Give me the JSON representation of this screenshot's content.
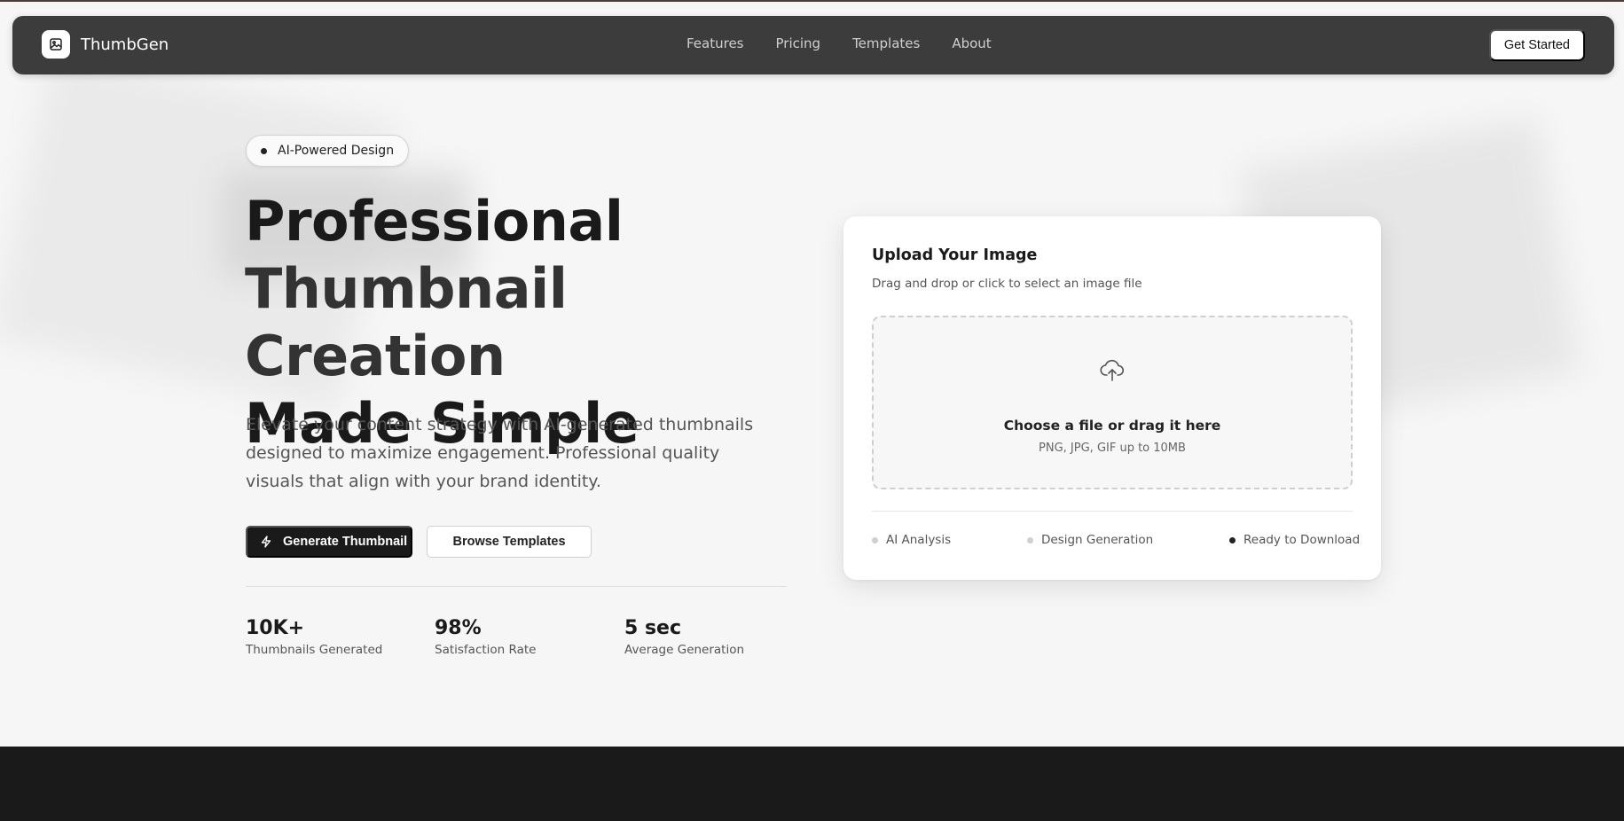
{
  "nav": {
    "logo_text": "ThumbGen",
    "links": [
      "Features",
      "Pricing",
      "Templates",
      "About"
    ],
    "cta_label": "Get Started"
  },
  "hero": {
    "badge": "AI-Powered Design",
    "title_lines": [
      "Professional",
      "Thumbnail Creation",
      "Made Simple"
    ],
    "description": "Elevate your content strategy with AI-generated thumbnails designed to maximize engagement. Professional quality visuals that align with your brand identity.",
    "primary_button": "Generate Thumbnail",
    "secondary_button": "Browse Templates",
    "stats": [
      {
        "value": "10K+",
        "label": "Thumbnails Generated"
      },
      {
        "value": "98%",
        "label": "Satisfaction Rate"
      },
      {
        "value": "5 sec",
        "label": "Average Generation"
      }
    ]
  },
  "upload": {
    "title": "Upload Your Image",
    "subtitle": "Drag and drop or click to select an image file",
    "drop_title": "Choose a file or drag it here",
    "drop_hint": "PNG, JPG, GIF up to 10MB",
    "steps": [
      {
        "label": "AI Analysis",
        "color": "#cfcfcf"
      },
      {
        "label": "Design Generation",
        "color": "#cfcfcf"
      },
      {
        "label": "Ready to Download",
        "color": "#222222"
      }
    ]
  },
  "icons": {
    "logo": "image-icon",
    "primary_button": "bolt-icon",
    "dropzone": "cloud-upload-icon"
  },
  "colors": {
    "nav_bg": "#3c3c3c",
    "primary": "#1a1a1a",
    "page_bg": "#f6f6f6"
  }
}
